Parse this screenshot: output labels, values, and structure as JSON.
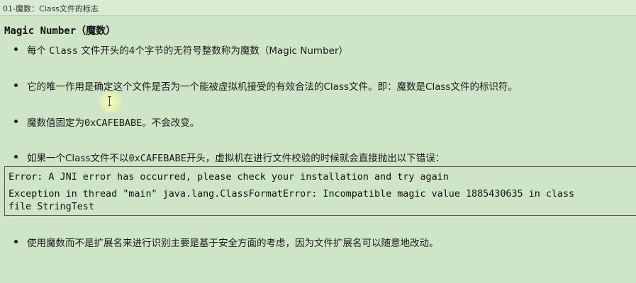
{
  "tab": {
    "title": "01-魔数：Class文件的标志"
  },
  "heading": "Magic Number（魔数）",
  "bullets": [
    {
      "before": "每个 ",
      "mono": "Class",
      "after": " 文件开头的4个字节的无符号整数称为魔数（Magic Number）"
    },
    {
      "text": "它的唯一作用是确定这个文件是否为一个能被虚拟机接受的有效合法的Class文件。即：魔数是Class文件的标识符。"
    },
    {
      "before": "魔数值固定为",
      "mono": "0xCAFEBABE",
      "after": "。不会改变。"
    },
    {
      "before": "如果一个Class文件不以",
      "mono": "0xCAFEBABE",
      "after": "开头，虚拟机在进行文件校验的时候就会直接抛出以下错误："
    },
    {
      "text": "使用魔数而不是扩展名来进行识别主要是基于安全方面的考虑，因为文件扩展名可以随意地改动。"
    }
  ],
  "code": {
    "line1": "Error: A JNI error has occurred, please check your installation and try again",
    "line2": "Exception in thread \"main\" java.lang.ClassFormatError: Incompatible magic value 1885430635 in class",
    "line3": "file StringTest"
  }
}
